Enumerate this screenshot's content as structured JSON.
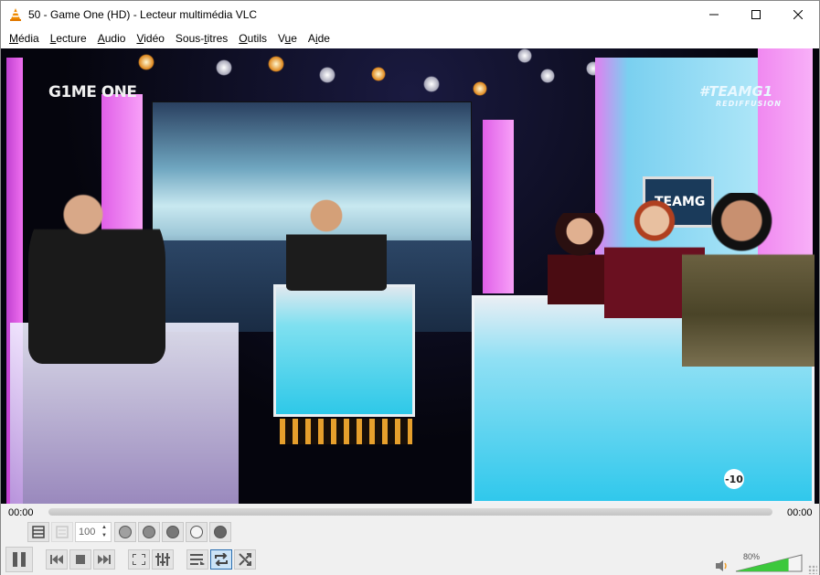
{
  "window": {
    "title": "50 - Game One (HD) - Lecteur multimédia VLC",
    "app_icon": "vlc-cone-icon",
    "controls": [
      "minimize-icon",
      "maximize-icon",
      "close-icon"
    ]
  },
  "menu": {
    "items": [
      {
        "label": "Média",
        "accel": "M"
      },
      {
        "label": "Lecture",
        "accel": "L"
      },
      {
        "label": "Audio",
        "accel": "A"
      },
      {
        "label": "Vidéo",
        "accel": "V"
      },
      {
        "label": "Sous-titres",
        "accel": "t"
      },
      {
        "label": "Outils",
        "accel": "O"
      },
      {
        "label": "Vue",
        "accel": "u"
      },
      {
        "label": "Aide",
        "accel": "i"
      }
    ]
  },
  "video": {
    "channel_logo": "G1ME ONE",
    "hashtag": "#TEAMG1",
    "rebroadcast": "REDIFFUSION",
    "rating_badge": "-10",
    "studio_screen_text": "TEAMG"
  },
  "playback": {
    "time_elapsed": "00:00",
    "time_total": "00:00",
    "progress": 0,
    "state": "playing",
    "loop_active": true
  },
  "advanced_controls": {
    "speed_value": "100",
    "buttons": [
      "layout-icon",
      "playlist-disabled-icon",
      "record-icon",
      "snapshot-icon",
      "ab-loop-icon",
      "frame-step-icon",
      "circle-icon"
    ]
  },
  "main_controls": {
    "buttons": [
      "pause-icon",
      "previous-icon",
      "stop-icon",
      "next-icon",
      "fullscreen-icon",
      "extended-settings-icon",
      "playlist-icon",
      "loop-icon",
      "shuffle-icon"
    ]
  },
  "volume": {
    "label": "80%",
    "level": 0.8,
    "color": "#3cc83c"
  }
}
